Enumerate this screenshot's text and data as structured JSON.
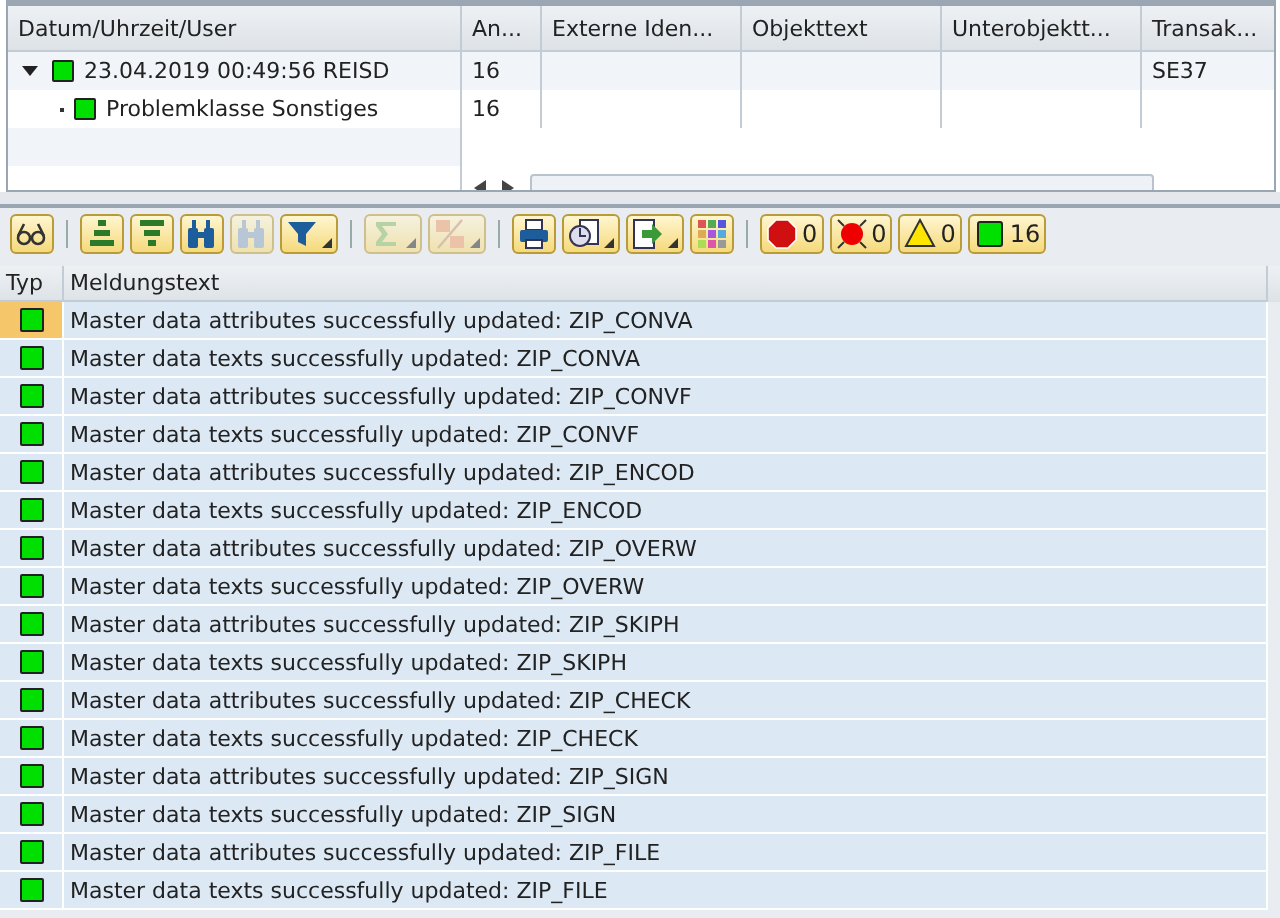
{
  "tree": {
    "columns": [
      "Datum/Uhrzeit/User",
      "An...",
      "Externe Iden...",
      "Objekttext",
      "Unterobjektt...",
      "Transak..."
    ],
    "rows": [
      {
        "expanded": true,
        "color": "#00e000",
        "cells": [
          "23.04.2019  00:49:56  REISD",
          "16",
          "",
          "",
          "",
          "SE37"
        ]
      },
      {
        "color": "#00e000",
        "cells": [
          "Problemklasse Sonstiges",
          "16",
          "",
          "",
          "",
          ""
        ]
      }
    ]
  },
  "toolbar": [
    {
      "kind": "button"
    },
    {
      "kind": "sep"
    },
    {
      "kind": "button"
    },
    {
      "kind": "button"
    },
    {
      "kind": "button"
    },
    {
      "kind": "button",
      "disabled": true
    },
    {
      "kind": "dropdown"
    },
    {
      "kind": "sep"
    },
    {
      "kind": "dropdown",
      "disabled": true
    },
    {
      "kind": "dropdown",
      "disabled": true
    },
    {
      "kind": "sep"
    },
    {
      "kind": "button"
    },
    {
      "kind": "dropdown"
    },
    {
      "kind": "dropdown"
    },
    {
      "kind": "button"
    },
    {
      "kind": "sep"
    },
    {
      "kind": "counter",
      "count": "0"
    },
    {
      "kind": "counter",
      "count": "0"
    },
    {
      "kind": "counter",
      "count": "0"
    },
    {
      "kind": "counter",
      "count": "16"
    }
  ],
  "messages": {
    "columns": [
      "Typ",
      "Meldungstext"
    ],
    "rows": [
      {
        "text": "Master data attributes successfully updated: ZIP_CONVA",
        "selected": true
      },
      {
        "text": "Master data texts successfully updated: ZIP_CONVA",
        "selected": false
      },
      {
        "text": "Master data attributes successfully updated: ZIP_CONVF",
        "selected": false
      },
      {
        "text": "Master data texts successfully updated: ZIP_CONVF",
        "selected": false
      },
      {
        "text": "Master data attributes successfully updated: ZIP_ENCOD",
        "selected": false
      },
      {
        "text": "Master data texts successfully updated: ZIP_ENCOD",
        "selected": false
      },
      {
        "text": "Master data attributes successfully updated: ZIP_OVERW",
        "selected": false
      },
      {
        "text": "Master data texts successfully updated: ZIP_OVERW",
        "selected": false
      },
      {
        "text": "Master data attributes successfully updated: ZIP_SKIPH",
        "selected": false
      },
      {
        "text": "Master data texts successfully updated: ZIP_SKIPH",
        "selected": false
      },
      {
        "text": "Master data attributes successfully updated: ZIP_CHECK",
        "selected": false
      },
      {
        "text": "Master data texts successfully updated: ZIP_CHECK",
        "selected": false
      },
      {
        "text": "Master data attributes successfully updated: ZIP_SIGN",
        "selected": false
      },
      {
        "text": "Master data texts successfully updated: ZIP_SIGN",
        "selected": false
      },
      {
        "text": "Master data attributes successfully updated: ZIP_FILE",
        "selected": false
      },
      {
        "text": "Master data texts successfully updated: ZIP_FILE",
        "selected": false
      }
    ]
  }
}
